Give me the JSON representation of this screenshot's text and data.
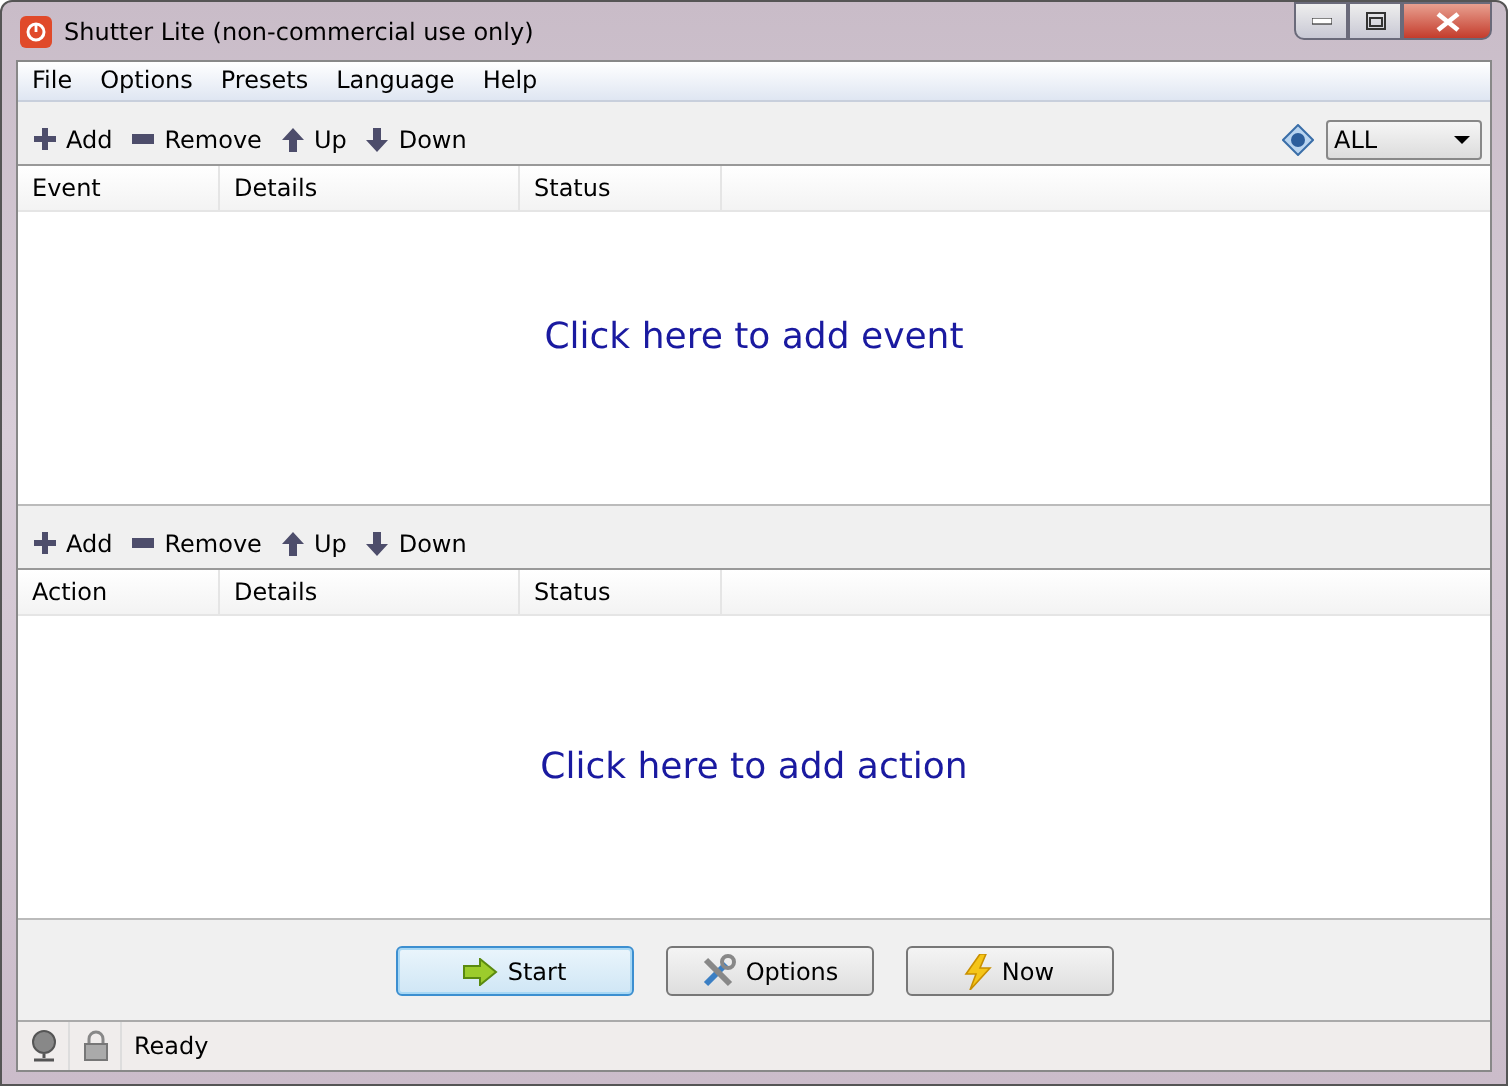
{
  "window": {
    "title": "Shutter Lite (non-commercial use only)"
  },
  "menu": [
    "File",
    "Options",
    "Presets",
    "Language",
    "Help"
  ],
  "events": {
    "toolbar": [
      {
        "label": "Add",
        "kind": "add"
      },
      {
        "label": "Remove",
        "kind": "remove"
      },
      {
        "label": "Up",
        "kind": "up"
      },
      {
        "label": "Down",
        "kind": "down"
      }
    ],
    "filter": "ALL",
    "columns": [
      "Event",
      "Details",
      "Status"
    ],
    "prompt": "Click here to add event"
  },
  "actions": {
    "toolbar": [
      {
        "label": "Add",
        "kind": "add"
      },
      {
        "label": "Remove",
        "kind": "remove"
      },
      {
        "label": "Up",
        "kind": "up"
      },
      {
        "label": "Down",
        "kind": "down"
      }
    ],
    "columns": [
      "Action",
      "Details",
      "Status"
    ],
    "prompt": "Click here to add action"
  },
  "buttons": [
    {
      "label": "Start",
      "kind": "start",
      "default": true
    },
    {
      "label": "Options",
      "kind": "options",
      "default": false
    },
    {
      "label": "Now",
      "kind": "now",
      "default": false
    }
  ],
  "status_bar": {
    "text": "Ready"
  }
}
